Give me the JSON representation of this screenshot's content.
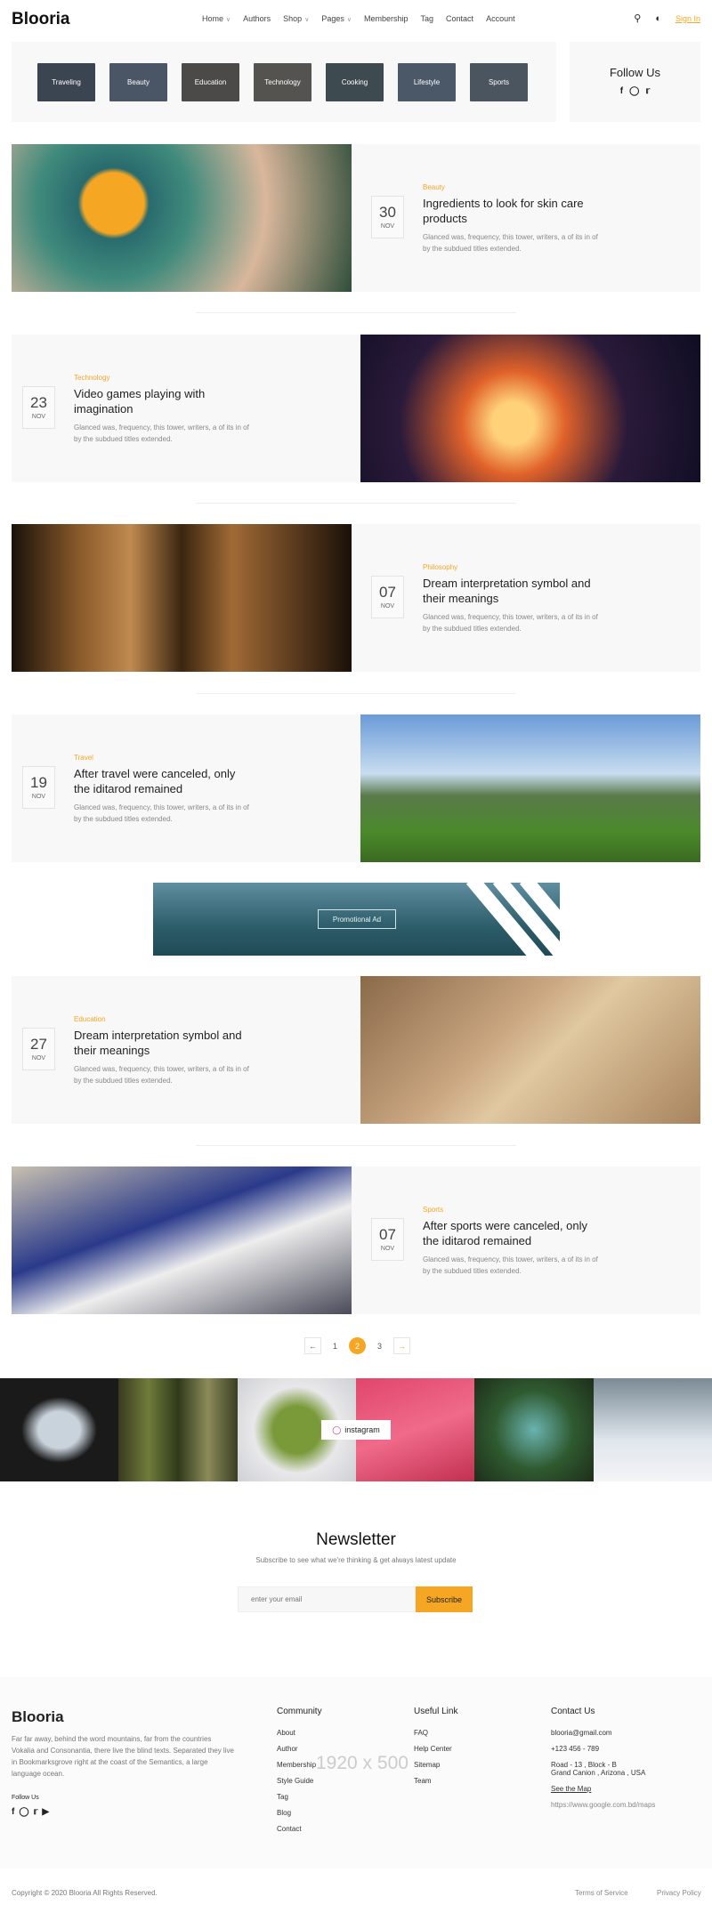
{
  "brand": "Blooria",
  "nav": [
    {
      "label": "Home",
      "dropdown": true
    },
    {
      "label": "Authors"
    },
    {
      "label": "Shop",
      "dropdown": true
    },
    {
      "label": "Pages",
      "dropdown": true
    },
    {
      "label": "Membership"
    },
    {
      "label": "Tag"
    },
    {
      "label": "Contact"
    },
    {
      "label": "Account"
    }
  ],
  "header": {
    "search_icon": "search-icon",
    "theme_icon": "dark-mode-icon",
    "signin": "Sign In"
  },
  "categories": [
    "Traveling",
    "Beauty",
    "Education",
    "Technology",
    "Cooking",
    "Lifestyle",
    "Sports"
  ],
  "follow": {
    "title": "Follow Us",
    "icons": [
      "facebook-icon",
      "instagram-icon",
      "twitter-icon"
    ]
  },
  "posts": [
    {
      "category": "Beauty",
      "day": "30",
      "month": "NOV",
      "title": "Ingredients to look for skin care products",
      "excerpt": "Glanced was, frequency, this tower, writers, a of its in of by the subdued titles extended.",
      "image_side": "left"
    },
    {
      "category": "Technology",
      "day": "23",
      "month": "NOV",
      "title": "Video games playing with imagination",
      "excerpt": "Glanced was, frequency, this tower, writers, a of its in of by the subdued titles extended.",
      "image_side": "right"
    },
    {
      "category": "Philosophy",
      "day": "07",
      "month": "NOV",
      "title": "Dream interpretation symbol and their meanings",
      "excerpt": "Glanced was, frequency, this tower, writers, a of its in of by the subdued titles extended.",
      "image_side": "left"
    },
    {
      "category": "Travel",
      "day": "19",
      "month": "NOV",
      "title": "After travel were canceled, only the iditarod remained",
      "excerpt": "Glanced was, frequency, this tower, writers, a of its in of by the subdued titles extended.",
      "image_side": "right"
    },
    {
      "category": "Education",
      "day": "27",
      "month": "NOV",
      "title": "Dream interpretation symbol and their meanings",
      "excerpt": "Glanced was, frequency, this tower, writers, a of its in of by the subdued titles extended.",
      "image_side": "right"
    },
    {
      "category": "Sports",
      "day": "07",
      "month": "NOV",
      "title": "After sports were canceled, only the iditarod remained",
      "excerpt": "Glanced was, frequency, this tower, writers, a of its in of by the subdued titles extended.",
      "image_side": "left"
    }
  ],
  "promo": {
    "label": "Promotional Ad"
  },
  "pagination": {
    "pages": [
      "1",
      "2",
      "3"
    ],
    "current": "2"
  },
  "instagram": {
    "label": "instagram"
  },
  "newsletter": {
    "title": "Newsletter",
    "subtitle": "Subscribe to see what we're thinking & get always latest update",
    "placeholder": "enter your email",
    "button": "Subscribe"
  },
  "footer": {
    "brand": "Blooria",
    "description": "Far far away, behind the word mountains, far from the countries Vokalia and Consonantia, there live the blind texts. Separated they live in Bookmarksgrove right at the coast of the Semantics, a large language ocean.",
    "follow": "Follow Us",
    "community": {
      "title": "Community",
      "links": [
        "About",
        "Author",
        "Membership",
        "Style Guide",
        "Tag",
        "Blog",
        "Contact"
      ]
    },
    "useful": {
      "title": "Useful Link",
      "links": [
        "FAQ",
        "Help Center",
        "Sitemap",
        "Team"
      ]
    },
    "contact": {
      "title": "Contact Us",
      "email": "blooria@gmail.com",
      "phone": "+123 456 - 789",
      "address1": "Road - 13 , Block - B",
      "address2": "Grand Canion , Arizona , USA",
      "map_label": "See the Map",
      "map_url": "https://www.google.com.bd/maps"
    },
    "placeholder_text": "1920 x 500",
    "copyright": "Copyright © 2020 Blooria All Rights Reserved.",
    "terms": "Terms of Service",
    "privacy": "Privacy Policy"
  },
  "colors": {
    "accent": "#f5a623",
    "panel": "#f8f8f9"
  }
}
